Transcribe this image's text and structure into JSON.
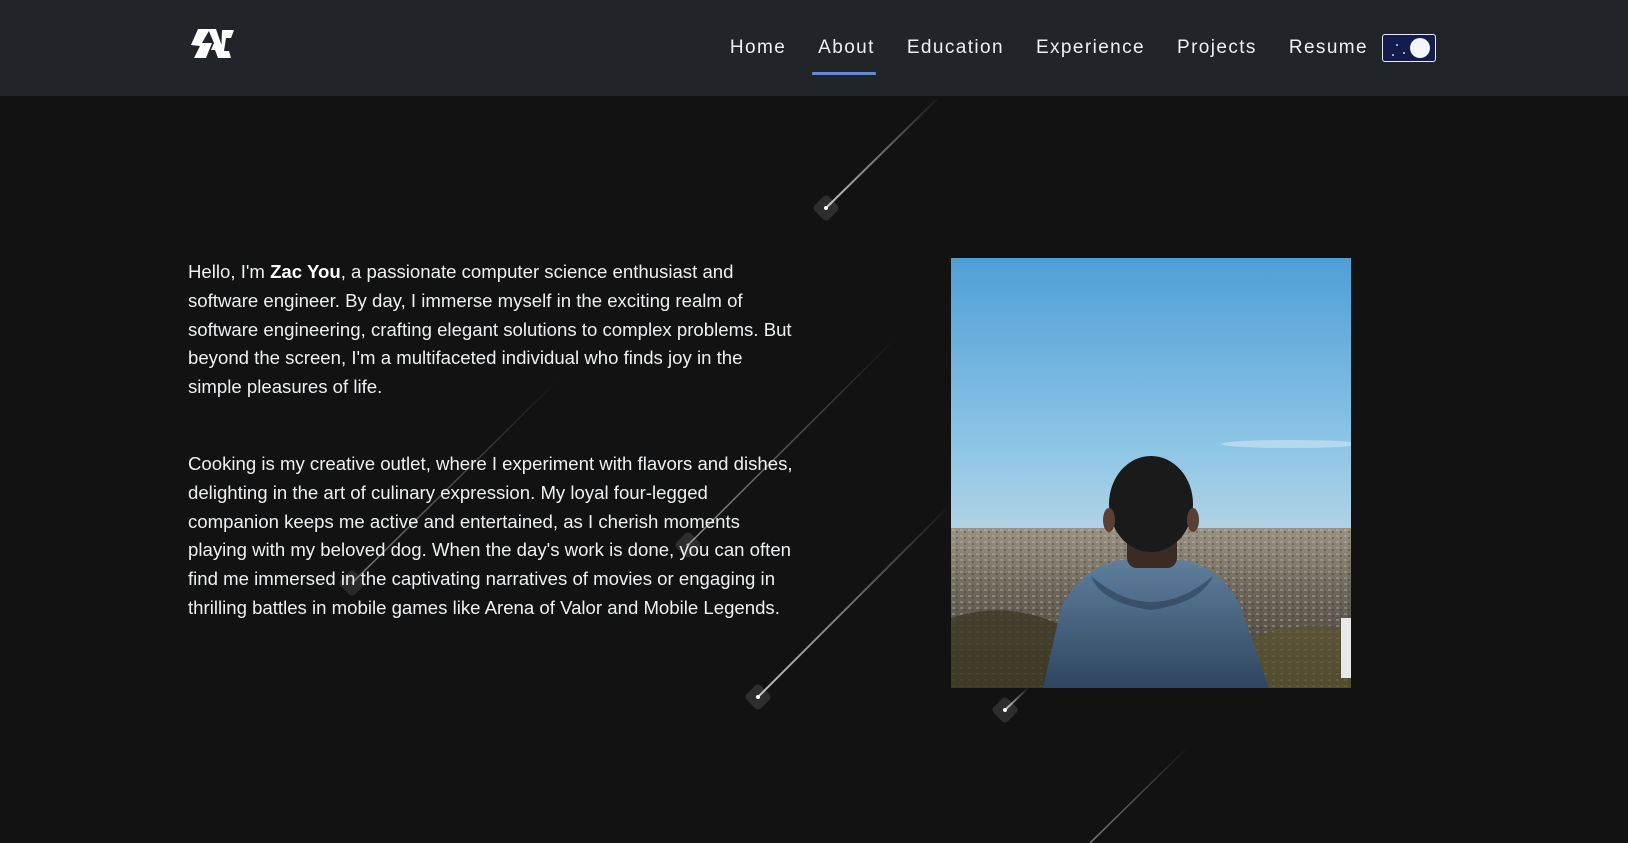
{
  "header": {
    "logo_text": "ZAC",
    "nav": [
      "Home",
      "About",
      "Education",
      "Experience",
      "Projects",
      "Resume"
    ],
    "active_nav": "About",
    "theme_toggle": "dark"
  },
  "about": {
    "intro_prefix": "Hello, I'm ",
    "name": "Zac You",
    "intro_suffix": ", a passionate computer science enthusiast and software engineer. By day, I immerse myself in the exciting realm of software engineering, crafting elegant solutions to complex problems. But beyond the screen, I'm a multifaceted individual who finds joy in the simple pleasures of life.",
    "paragraph_2": "Cooking is my creative outlet, where I experiment with flavors and dishes, delighting in the art of culinary expression. My loyal four-legged companion keeps me active and entertained, as I cherish moments playing with my beloved dog. When the day's work is done, you can often find me immersed in the captivating narratives of movies or engaging in thrilling battles in mobile games like Arena of Valor and Mobile Legends."
  },
  "colors": {
    "page_background": "#121212",
    "navbar_background": "#212429",
    "accent": "#5b8fd0",
    "toggle_background": "#141c4e",
    "text": "#eef0f2"
  },
  "icons": {
    "logo": "zac-logo-icon",
    "toggle": "moon-toggle-icon"
  }
}
